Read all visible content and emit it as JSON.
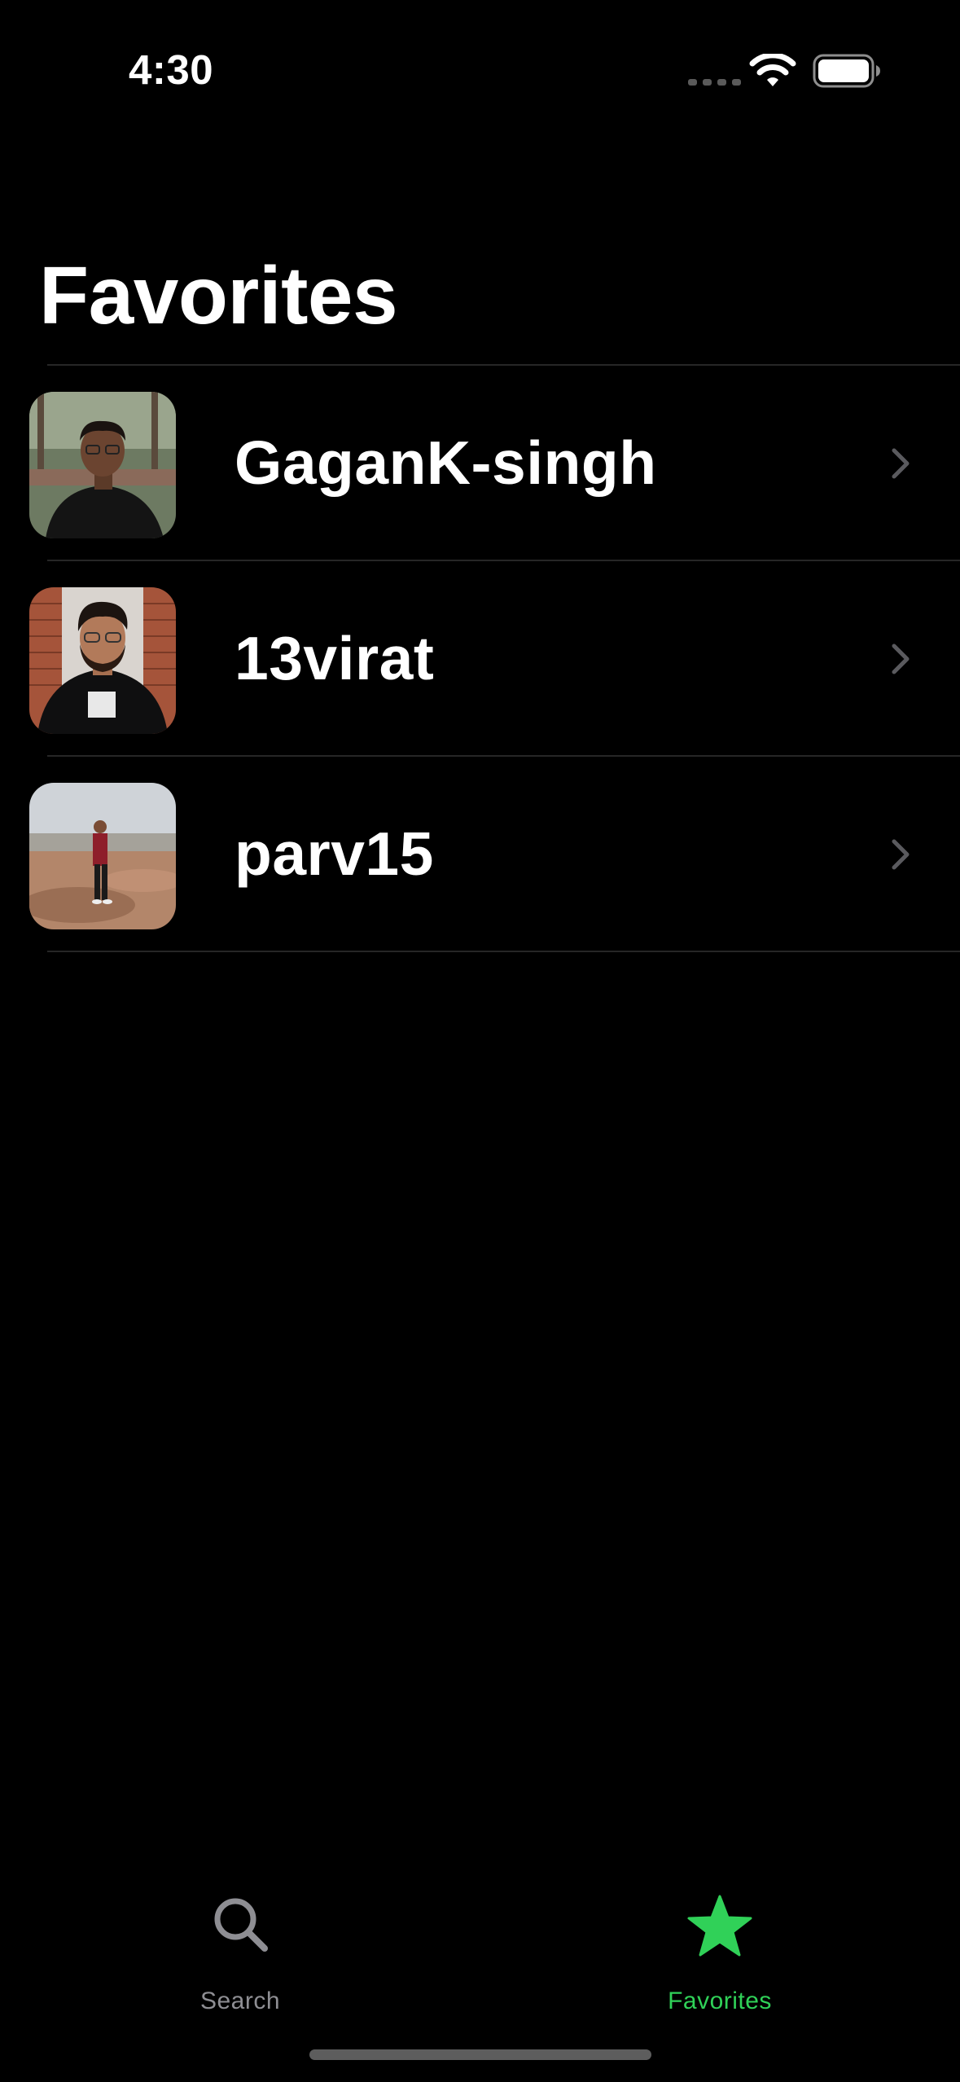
{
  "status_bar": {
    "time": "4:30",
    "signal_icon": "cellular-dots-icon",
    "wifi_icon": "wifi-icon",
    "battery_icon": "battery-icon"
  },
  "header": {
    "title": "Favorites"
  },
  "favorites": [
    {
      "name": "GaganK-singh",
      "avatar_icon": "user-photo"
    },
    {
      "name": "13virat",
      "avatar_icon": "user-photo"
    },
    {
      "name": "parv15",
      "avatar_icon": "user-photo"
    }
  ],
  "tab_bar": {
    "tabs": [
      {
        "label": "Search",
        "icon": "magnifying-glass-icon",
        "active": false
      },
      {
        "label": "Favorites",
        "icon": "star-icon",
        "active": true
      }
    ]
  },
  "colors": {
    "background": "#000000",
    "accent": "#30D158",
    "inactive_tab": "#8E8E93",
    "separator": "#262626",
    "chevron": "#5A5A5E"
  }
}
